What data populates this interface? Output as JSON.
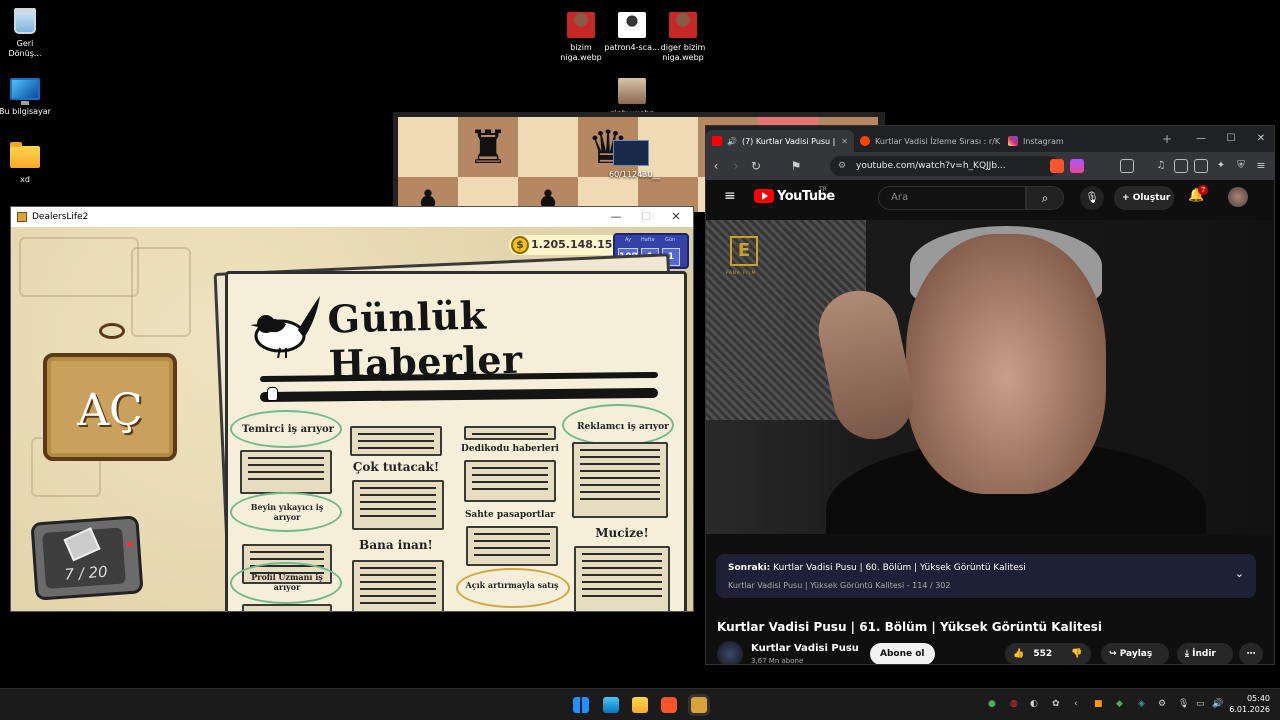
{
  "desktop": {
    "icons": [
      {
        "label": "Geri\nDönüş...",
        "icon": "recycle-bin-icon"
      },
      {
        "label": "Bu bilgisayar",
        "icon": "this-pc-icon"
      },
      {
        "label": "xd",
        "icon": "folder-icon"
      },
      {
        "label": "bizim\nniga.webp",
        "icon": "image-file-icon"
      },
      {
        "label": "patron4-sca...",
        "icon": "image-file-icon"
      },
      {
        "label": "diger bizim\nniga.webp",
        "icon": "image-file-icon"
      },
      {
        "label": "giphy.webp",
        "icon": "image-file-icon"
      }
    ],
    "overlay_label": "60/112430__"
  },
  "dealerslife": {
    "window_title": "DealersLife2",
    "money": "1.205.148.157",
    "currency_symbol": "$",
    "calendar": {
      "labels": [
        "Ay",
        "Hafta",
        "Gün"
      ],
      "values": [
        "108",
        "1",
        "1"
      ]
    },
    "open_sign": "AÇ",
    "counter": "7 / 20",
    "newspaper": {
      "title": "Günlük Haberler",
      "headlines": [
        "Temirci iş arıyor",
        "Çok tutacak!",
        "Dedikodu haberleri",
        "Reklamcı iş arıyor",
        "Beyin yıkayıcı iş arıyor",
        "Sahte pasaportlar",
        "Bana inan!",
        "Mucize!",
        "Profil Uzmanı iş arıyor",
        "Açık artırmayla satış"
      ]
    }
  },
  "browser": {
    "tabs": [
      {
        "label": "(7) Kurtlar Vadisi Pusu |",
        "active": true
      },
      {
        "label": "Kurtlar Vadisi İzleme Sırası : r/K",
        "active": false
      },
      {
        "label": "Instagram",
        "active": false
      }
    ],
    "url": "youtube.com/watch?v=h_KQJJb...",
    "youtube": {
      "logo": "YouTube",
      "region": "TR",
      "search_placeholder": "Ara",
      "create_label": "Oluştur",
      "notif_count": "7",
      "next_up_label": "Sonraki:",
      "next_up_title": "Kurtlar Vadisi Pusu | 60. Bölüm | Yüksek Görüntü Kalitesi",
      "playlist_info": "Kurtlar Vadisi Pusu | Yüksek Görüntü Kalitesi - 114 / 302",
      "video_title": "Kurtlar Vadisi Pusu | 61. Bölüm | Yüksek Görüntü Kalitesi",
      "channel": "Kurtlar Vadisi Pusu",
      "subscribers": "3,67 Mn abone",
      "subscribe": "Abone ol",
      "likes": "552",
      "share": "Paylaş",
      "download": "İndir",
      "video_logo": "E",
      "video_logo_caption": "PANA FILM"
    }
  },
  "taskbar": {
    "time": "05:40",
    "date": "6.01.2026"
  },
  "colors": {
    "yt_red": "#ff0000",
    "taskbar_bg": "#1b1b1b",
    "calendar_blue": "#3442a8",
    "circle_green": "#74b98a",
    "circle_gold": "#d1a642"
  }
}
